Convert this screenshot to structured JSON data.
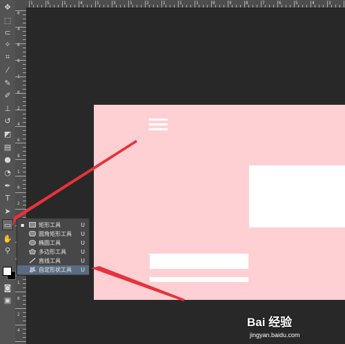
{
  "toolbar": {
    "tools": [
      {
        "name": "move-tool-icon",
        "glyph": "✥"
      },
      {
        "name": "marquee-tool-icon",
        "glyph": "⬚"
      },
      {
        "name": "lasso-tool-icon",
        "glyph": "⊂"
      },
      {
        "name": "quick-selection-tool-icon",
        "glyph": "✧"
      },
      {
        "name": "crop-tool-icon",
        "glyph": "⌗"
      },
      {
        "name": "eyedropper-tool-icon",
        "glyph": "⁄"
      },
      {
        "name": "healing-brush-tool-icon",
        "glyph": "✎"
      },
      {
        "name": "brush-tool-icon",
        "glyph": "✐"
      },
      {
        "name": "clone-stamp-tool-icon",
        "glyph": "⊥"
      },
      {
        "name": "history-brush-tool-icon",
        "glyph": "↺"
      },
      {
        "name": "eraser-tool-icon",
        "glyph": "◩"
      },
      {
        "name": "gradient-tool-icon",
        "glyph": "▤"
      },
      {
        "name": "blur-tool-icon",
        "glyph": "●"
      },
      {
        "name": "dodge-tool-icon",
        "glyph": "◔"
      },
      {
        "name": "pen-tool-icon",
        "glyph": "✒"
      },
      {
        "name": "type-tool-icon",
        "glyph": "T"
      },
      {
        "name": "path-selection-tool-icon",
        "glyph": "➤"
      },
      {
        "name": "shape-tool-icon",
        "glyph": "▭"
      },
      {
        "name": "hand-tool-icon",
        "glyph": "✋"
      },
      {
        "name": "zoom-tool-icon",
        "glyph": "⚲"
      },
      {
        "name": "quick-mask-icon",
        "glyph": "◙"
      },
      {
        "name": "screen-mode-icon",
        "glyph": "▣"
      }
    ]
  },
  "ruler": {
    "top_numbers": [
      "1",
      "5",
      "1",
      "4",
      "1",
      "3",
      "1",
      "2",
      "1",
      "1",
      "1",
      "0",
      "9",
      "8",
      "7",
      "6",
      "5",
      "4",
      "3"
    ],
    "left_numbers": [
      "0",
      "4",
      "6",
      "8",
      "1",
      "0",
      "2",
      "4",
      "6",
      "8",
      "1",
      "0",
      "2",
      "2",
      "4",
      "6",
      "8",
      "1",
      "0",
      "2",
      "4"
    ]
  },
  "shape_flyout": {
    "items": [
      {
        "label": "矩形工具",
        "key": "U",
        "icon": "rectangle-icon",
        "current": true
      },
      {
        "label": "圆角矩形工具",
        "key": "U",
        "icon": "rounded-rectangle-icon",
        "current": false
      },
      {
        "label": "椭圆工具",
        "key": "U",
        "icon": "ellipse-icon",
        "current": false
      },
      {
        "label": "多边形工具",
        "key": "U",
        "icon": "polygon-icon",
        "current": false
      },
      {
        "label": "直线工具",
        "key": "U",
        "icon": "line-icon",
        "current": false
      },
      {
        "label": "自定形状工具",
        "key": "U",
        "icon": "custom-shape-icon",
        "current": false,
        "highlighted": true
      }
    ]
  },
  "watermark": {
    "main": "Bai 经验",
    "sub": "jingyan.baidu.com"
  },
  "colors": {
    "canvas": "#ffd0d3",
    "workspace": "#282828",
    "arrow": "#e8323c",
    "flyout_highlight": "#5a6c83"
  }
}
